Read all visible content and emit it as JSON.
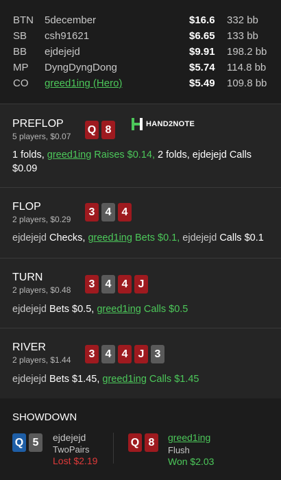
{
  "players": [
    {
      "pos": "BTN",
      "name": "5december",
      "stack": "$16.6",
      "bb": "332 bb",
      "hero": false
    },
    {
      "pos": "SB",
      "name": "csh91621",
      "stack": "$6.65",
      "bb": "133 bb",
      "hero": false
    },
    {
      "pos": "BB",
      "name": "ejdejejd",
      "stack": "$9.91",
      "bb": "198.2 bb",
      "hero": false
    },
    {
      "pos": "MP",
      "name": "DyngDyngDong",
      "stack": "$5.74",
      "bb": "114.8 bb",
      "hero": false
    },
    {
      "pos": "CO",
      "name": "greed1ing",
      "hero_tag": " (Hero)",
      "stack": "$5.49",
      "bb": "109.8 bb",
      "hero": true
    }
  ],
  "logo": {
    "text": "HAND2NOTE",
    "color": "#4cc85a"
  },
  "streets": {
    "preflop": {
      "name": "PREFLOP",
      "info": "5 players, $0.07",
      "cards": [
        "Q",
        "8"
      ],
      "action": {
        "a1": "1 folds, ",
        "a2": "greed1ing",
        "a3": " Raises $0.14, ",
        "a4": "2 folds, ejdejejd ",
        "a5": "Calls",
        "a6": "$0.09"
      }
    },
    "flop": {
      "name": "FLOP",
      "info": "2 players, $0.29",
      "cards": [
        "3",
        "4",
        "4"
      ],
      "action": {
        "a1": "ejdejejd ",
        "a2": "Checks, ",
        "a3": "greed1ing",
        "a4": " Bets $0.1, ",
        "a5": "ejdejejd ",
        "a6": "Calls $0.1"
      }
    },
    "turn": {
      "name": "TURN",
      "info": "2 players, $0.48",
      "cards": [
        "3",
        "4",
        "4",
        "J"
      ],
      "action": {
        "a1": "ejdejejd ",
        "a2": "Bets $0.5, ",
        "a3": "greed1ing",
        "a4": " Calls $0.5"
      }
    },
    "river": {
      "name": "RIVER",
      "info": "2 players, $1.44",
      "cards": [
        "3",
        "4",
        "4",
        "J",
        "3"
      ],
      "action": {
        "a1": "ejdejejd ",
        "a2": "Bets $1.45, ",
        "a3": "greed1ing",
        "a4": " Calls $1.45"
      }
    }
  },
  "showdown": {
    "title": "SHOWDOWN",
    "villain": {
      "cards": [
        "Q",
        "5"
      ],
      "name": "ejdejejd",
      "hand": "TwoPairs",
      "result": "Lost $2.19"
    },
    "hero": {
      "cards": [
        "Q",
        "8"
      ],
      "name": "greed1ing",
      "hand": "Flush",
      "result": "Won $2.03"
    }
  },
  "colors": {
    "hero": "#4cc85a",
    "lost": "#e03a3a",
    "card_red": "#9e1a1f",
    "card_gray": "#5a5a5a",
    "card_blue": "#1e5ea6"
  }
}
